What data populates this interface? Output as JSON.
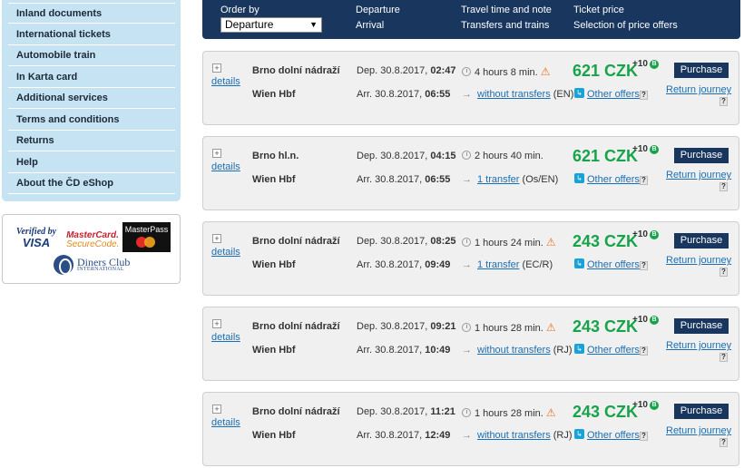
{
  "sidebar": {
    "items": [
      {
        "label": "Inland documents"
      },
      {
        "label": "International tickets"
      },
      {
        "label": "Automobile train"
      },
      {
        "label": "In Karta card"
      },
      {
        "label": "Additional services"
      },
      {
        "label": "Terms and conditions"
      },
      {
        "label": "Returns"
      },
      {
        "label": "Help"
      },
      {
        "label": "About the ČD eShop"
      }
    ]
  },
  "payments": {
    "visa_line1": "Verified by",
    "visa_line2": "VISA",
    "mc_line1": "MasterCard.",
    "mc_line2": "SecureCode.",
    "masterpass": "MasterPass",
    "diners_line1": "Diners Club",
    "diners_line2": "INTERNATIONAL"
  },
  "header": {
    "order_by": "Order by",
    "order_value": "Departure",
    "departure": "Departure",
    "arrival": "Arrival",
    "travel_time": "Travel time and note",
    "transfers": "Transfers and trains",
    "ticket_price": "Ticket price",
    "selection": "Selection of price offers"
  },
  "common": {
    "details": "details",
    "purchase": "Purchase",
    "other_offers": "Other offers",
    "return_journey": "Return journey",
    "plus": "+",
    "question": "?",
    "bonus": "+10"
  },
  "connections": [
    {
      "from": "Brno dolní nádraží",
      "to": "Wien Hbf",
      "dep_date": "Dep. 30.8.2017, ",
      "dep_time": "02:47",
      "arr_date": "Arr. 30.8.2017, ",
      "arr_time": "06:55",
      "duration": "4 hours 8 min.",
      "warning": true,
      "transfer_link": "without transfers",
      "trains": " (EN)",
      "price": "621 CZK"
    },
    {
      "from": "Brno hl.n.",
      "to": "Wien Hbf",
      "dep_date": "Dep. 30.8.2017, ",
      "dep_time": "04:15",
      "arr_date": "Arr. 30.8.2017, ",
      "arr_time": "06:55",
      "duration": "2 hours 40 min.",
      "warning": false,
      "transfer_link": "1 transfer",
      "trains": " (Os/EN)",
      "price": "621 CZK"
    },
    {
      "from": "Brno dolní nádraží",
      "to": "Wien Hbf",
      "dep_date": "Dep. 30.8.2017, ",
      "dep_time": "08:25",
      "arr_date": "Arr. 30.8.2017, ",
      "arr_time": "09:49",
      "duration": "1 hours 24 min.",
      "warning": true,
      "transfer_link": "1 transfer",
      "trains": " (EC/R)",
      "price": "243 CZK"
    },
    {
      "from": "Brno dolní nádraží",
      "to": "Wien Hbf",
      "dep_date": "Dep. 30.8.2017, ",
      "dep_time": "09:21",
      "arr_date": "Arr. 30.8.2017, ",
      "arr_time": "10:49",
      "duration": "1 hours 28 min.",
      "warning": true,
      "transfer_link": "without transfers",
      "trains": " (RJ)",
      "price": "243 CZK"
    },
    {
      "from": "Brno dolní nádraží",
      "to": "Wien Hbf",
      "dep_date": "Dep. 30.8.2017, ",
      "dep_time": "11:21",
      "arr_date": "Arr. 30.8.2017, ",
      "arr_time": "12:49",
      "duration": "1 hours 28 min.",
      "warning": true,
      "transfer_link": "without transfers",
      "trains": " (RJ)",
      "price": "243 CZK"
    }
  ],
  "colors": {
    "accent": "#18365e",
    "price": "#17a34a",
    "link": "#1a6fb4",
    "sidebar_bg": "#c5e3f3"
  },
  "icons": [
    "clock-icon",
    "warning-icon",
    "arrow-right-icon",
    "bonus-icon",
    "offer-icon",
    "help-icon",
    "expand-icon"
  ]
}
